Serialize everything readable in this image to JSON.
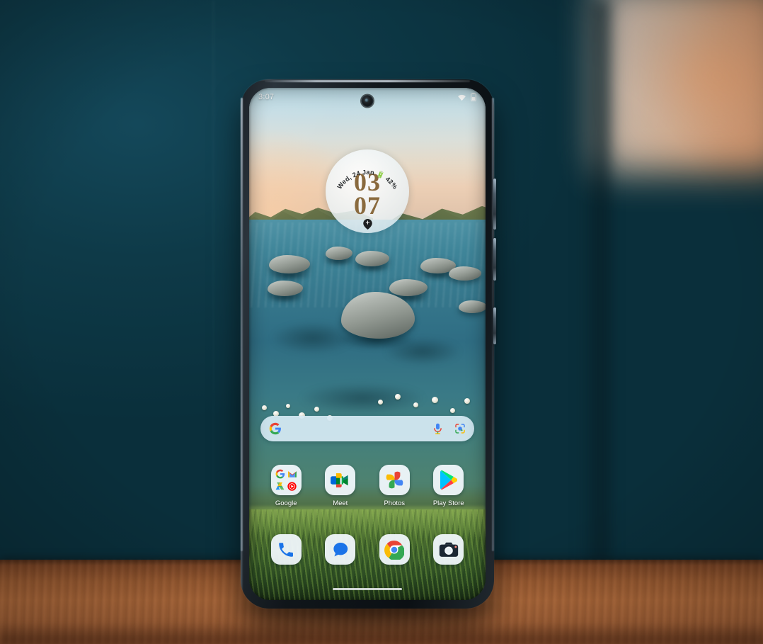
{
  "scene": {
    "description": "Smartphone standing on a wooden desk against a dark teal wall with a warm blurred light panel on the right",
    "wall_color": "#0e3a48",
    "desk_color": "#a9663a",
    "bokeh_color": "#dd9d72"
  },
  "phone": {
    "frame_color": "#11171c",
    "buttons": [
      {
        "name": "volume-rocker"
      },
      {
        "name": "power-button"
      },
      {
        "name": "assistant-button"
      }
    ]
  },
  "status_bar": {
    "time": "3:07",
    "icons": [
      {
        "name": "wifi-icon"
      },
      {
        "name": "battery-icon"
      }
    ],
    "camera": "front-camera-punch-hole"
  },
  "clock_widget": {
    "header": "Wed, 24 Jan",
    "battery_text": "42%",
    "battery_icon": "battery-icon",
    "hours": "03",
    "minutes": "07",
    "footer_icon": "location-pin-icon",
    "digit_color": "#8a6a3e",
    "background_color": "#eef5f8"
  },
  "search": {
    "placeholder": "",
    "value": "",
    "logo_icon": "google-g-icon",
    "mic_icon": "microphone-icon",
    "lens_icon": "google-lens-icon",
    "background_color": "#d6e9f3"
  },
  "app_grid": [
    {
      "label": "Google",
      "icon": "google-folder-icon",
      "folder_apps": [
        "google-search-icon",
        "gmail-icon",
        "google-drive-icon",
        "youtube-music-icon"
      ]
    },
    {
      "label": "Meet",
      "icon": "google-meet-icon"
    },
    {
      "label": "Photos",
      "icon": "google-photos-icon"
    },
    {
      "label": "Play Store",
      "icon": "google-play-store-icon"
    }
  ],
  "dock": [
    {
      "label": "Phone",
      "icon": "phone-dialer-icon"
    },
    {
      "label": "Messages",
      "icon": "messages-icon"
    },
    {
      "label": "Chrome",
      "icon": "chrome-icon"
    },
    {
      "label": "Camera",
      "icon": "camera-icon"
    }
  ],
  "navigation": {
    "gesture_pill": "home-gesture-pill"
  },
  "wallpaper": {
    "name": "coastal-rocks-wallpaper",
    "description": "Sunset coastline with rocky headlands, shallow teal water, stones and a grassy foreground"
  }
}
